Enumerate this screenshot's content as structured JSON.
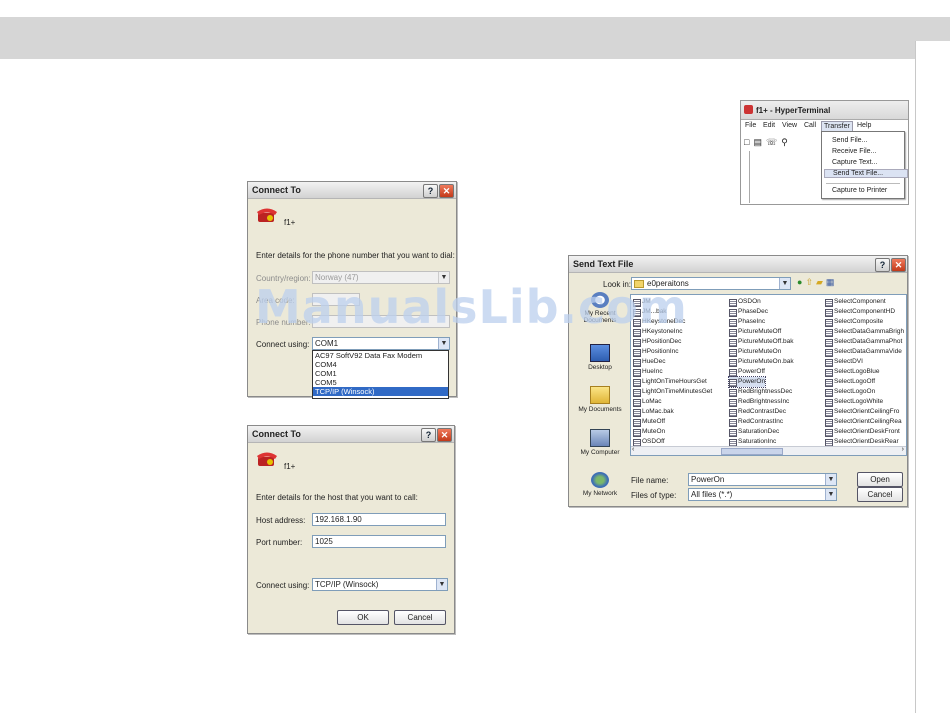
{
  "watermark": "ManualsLib.com",
  "connect_to_1": {
    "title": "Connect To",
    "name": "f1+",
    "prompt": "Enter details for the phone number that you want to dial:",
    "country_label": "Country/region:",
    "country_value": "Norway (47)",
    "area_label": "Area code:",
    "phone_label": "Phone number:",
    "connect_label": "Connect using:",
    "connect_value": "COM1",
    "options": [
      "AC97 SoftV92 Data Fax Modem",
      "COM4",
      "COM1",
      "COM5",
      "TCP/IP (Winsock)"
    ],
    "selected_option": "TCP/IP (Winsock)"
  },
  "connect_to_2": {
    "title": "Connect To",
    "name": "f1+",
    "prompt": "Enter details for the host that you want to call:",
    "host_label": "Host address:",
    "host_value": "192.168.1.90",
    "port_label": "Port number:",
    "port_value": "1025",
    "connect_label": "Connect using:",
    "connect_value": "TCP/IP (Winsock)",
    "ok_label": "OK",
    "cancel_label": "Cancel"
  },
  "hyperterminal": {
    "title": "f1+ - HyperTerminal",
    "menu": [
      "File",
      "Edit",
      "View",
      "Call",
      "Transfer",
      "Help"
    ],
    "active_menu": "Transfer",
    "submenu": [
      "Send File...",
      "Receive File...",
      "Capture Text...",
      "Send Text File...",
      "Capture to Printer"
    ],
    "highlighted": "Send Text File..."
  },
  "send_text_file": {
    "title": "Send Text File",
    "look_in_label": "Look in:",
    "look_in_value": "e0peraitons",
    "places": [
      "My Recent Documents",
      "Desktop",
      "My Documents",
      "My Computer",
      "My Network"
    ],
    "files_col1": [
      "JM",
      "JM...bak",
      "HKeystoneDec",
      "HKeystoneInc",
      "HPositionDec",
      "HPositionInc",
      "HueDec",
      "HueInc",
      "LightOnTimeHoursGet",
      "LightOnTimeMinutesGet",
      "LoMac",
      "LoMac.bak",
      "MuteOff",
      "MuteOn",
      "OSDOff"
    ],
    "files_col2": [
      "OSDOn",
      "PhaseDec",
      "PhaseInc",
      "PictureMuteOff",
      "PictureMuteOff.bak",
      "PictureMuteOn",
      "PictureMuteOn.bak",
      "PowerOff",
      "PowerOn",
      "RedBrightnessDec",
      "RedBrightnessInc",
      "RedContrastDec",
      "RedContrastInc",
      "SaturationDec",
      "SaturationInc"
    ],
    "files_col3": [
      "SelectComponent",
      "SelectComponentHD",
      "SelectComposite",
      "SelectDataGammaBrigh",
      "SelectDataGammaPhot",
      "SelectDataGammaVide",
      "SelectDVI",
      "SelectLogoBlue",
      "SelectLogoOff",
      "SelectLogoOn",
      "SelectLogoWhite",
      "SelectOrientCeilingFro",
      "SelectOrientCeilingRea",
      "SelectOrientDeskFront",
      "SelectOrientDeskRear"
    ],
    "selected_file": "PowerOn",
    "file_name_label": "File name:",
    "file_name_value": "PowerOn",
    "file_type_label": "Files of type:",
    "file_type_value": "All files (*.*)",
    "open_label": "Open",
    "cancel_label": "Cancel"
  }
}
